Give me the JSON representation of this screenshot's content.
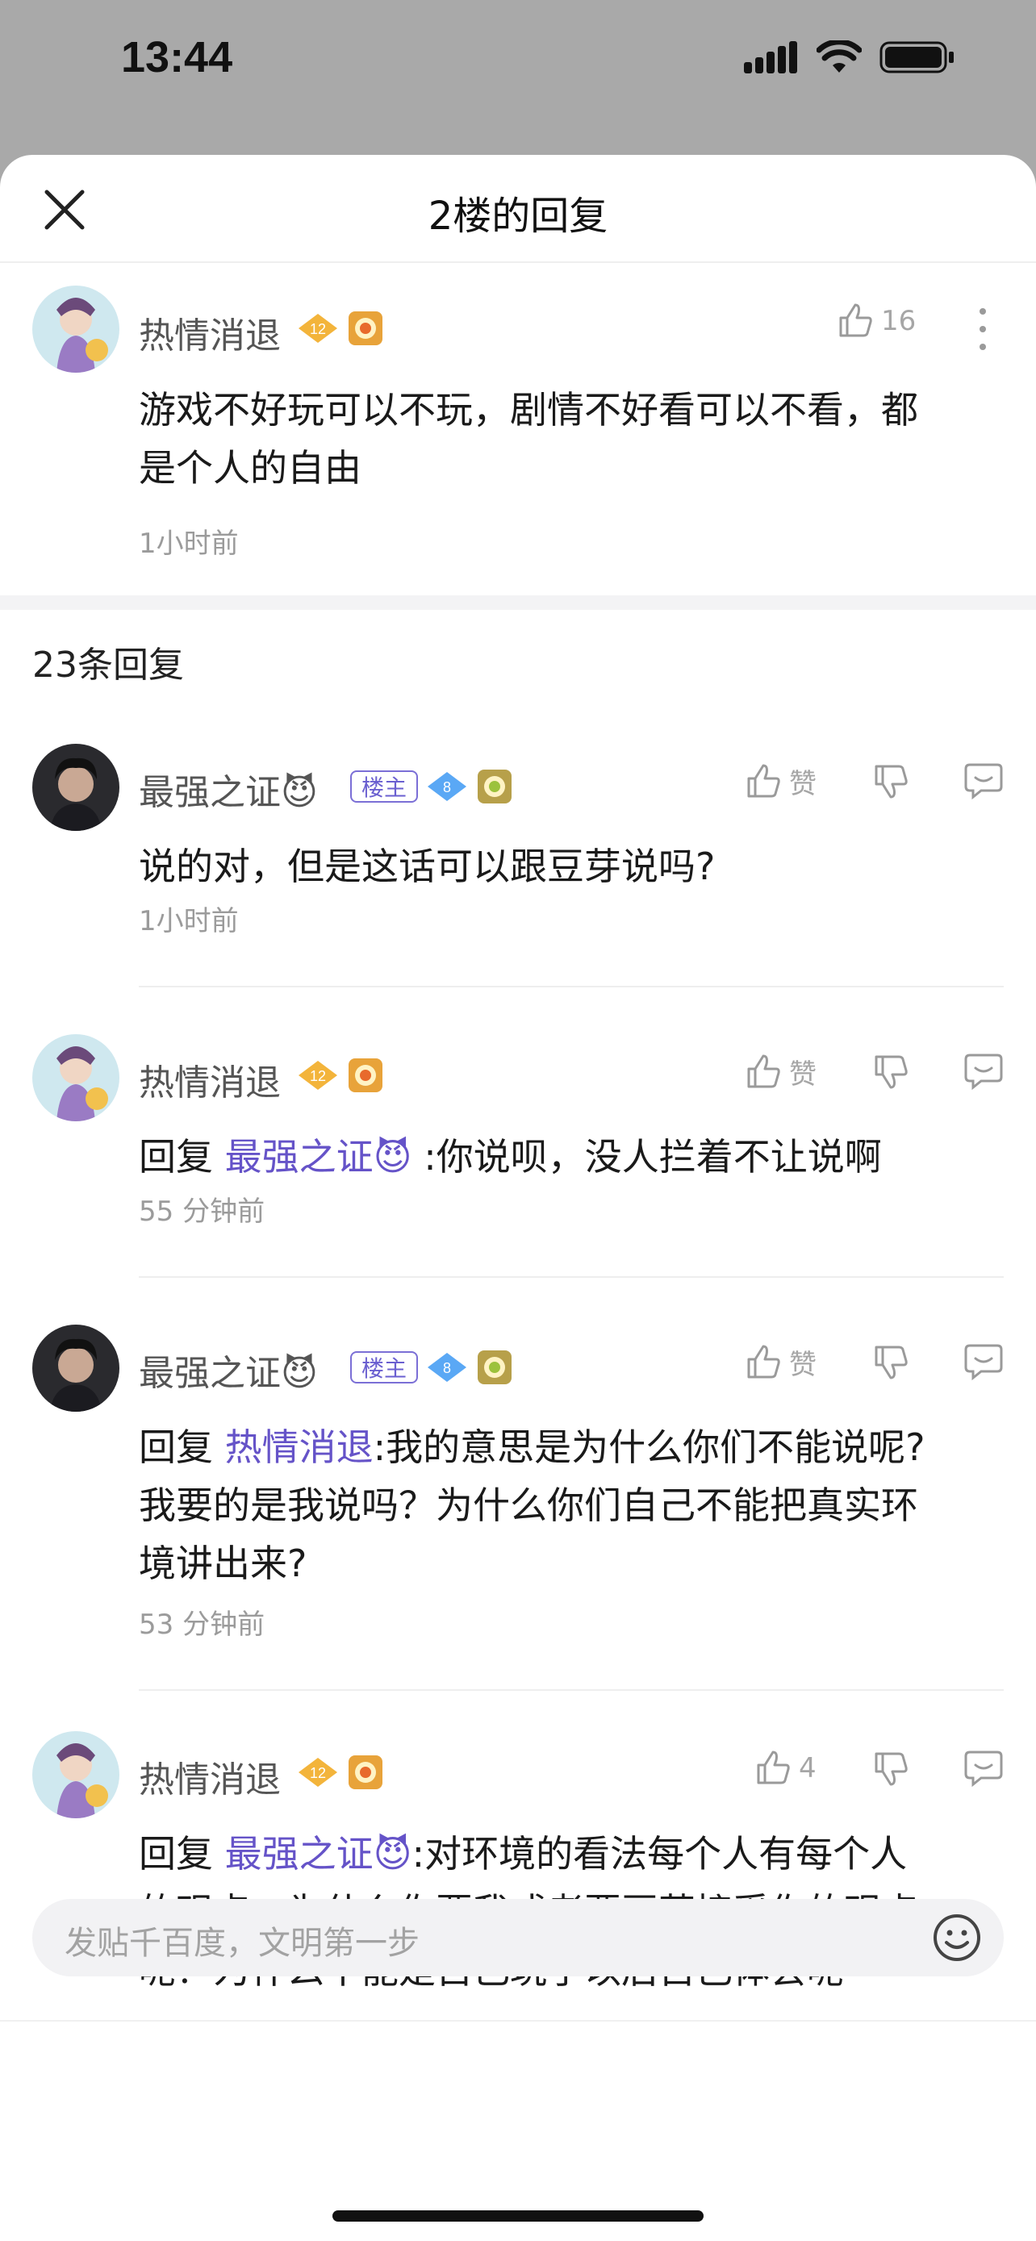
{
  "status": {
    "time": "13:44"
  },
  "header": {
    "title": "2楼的回复"
  },
  "main_comment": {
    "username": "热情消退",
    "level": "12",
    "likes": "16",
    "text_line1": "游戏不好玩可以不玩，剧情不好看可以不看，都",
    "text_line2": "是个人的自由",
    "time": "1小时前"
  },
  "replies_count_label": "23条回复",
  "replies": [
    {
      "username": "最强之证😈",
      "host_tag": "楼主",
      "level": "8",
      "like_label": "赞",
      "text": "说的对，但是这话可以跟豆芽说吗?",
      "time": "1小时前"
    },
    {
      "username": "热情消退",
      "level": "12",
      "like_label": "赞",
      "reply_prefix": "回复",
      "mention": "最强之证😈",
      "text": ":你说呗，没人拦着不让说啊",
      "time": "55 分钟前"
    },
    {
      "username": "最强之证😈",
      "host_tag": "楼主",
      "level": "8",
      "like_label": "赞",
      "reply_prefix": "回复",
      "mention": "热情消退",
      "text_line1": ":我的意思是为什么你们不能说呢?",
      "text_line2": "我要的是我说吗？为什么你们自己不能把真实环",
      "text_line3": "境讲出来?",
      "time": "53 分钟前"
    },
    {
      "username": "热情消退",
      "level": "12",
      "likes": "4",
      "reply_prefix": "回复",
      "mention": "最强之证😈",
      "text_line1": ":对环境的看法每个人有每个人",
      "text_line2": "的观点，为什么你要我或者要豆芽接受你的观点",
      "text_line3": "呢？为什么不能是自己玩了以后自己体会呢"
    }
  ],
  "input": {
    "placeholder": "发贴千百度，文明第一步"
  },
  "colors": {
    "mention": "#6553c8",
    "host_tag": "#7b6fd6",
    "level_gold": "#f3b43b",
    "level_blue": "#5aa8f5"
  }
}
